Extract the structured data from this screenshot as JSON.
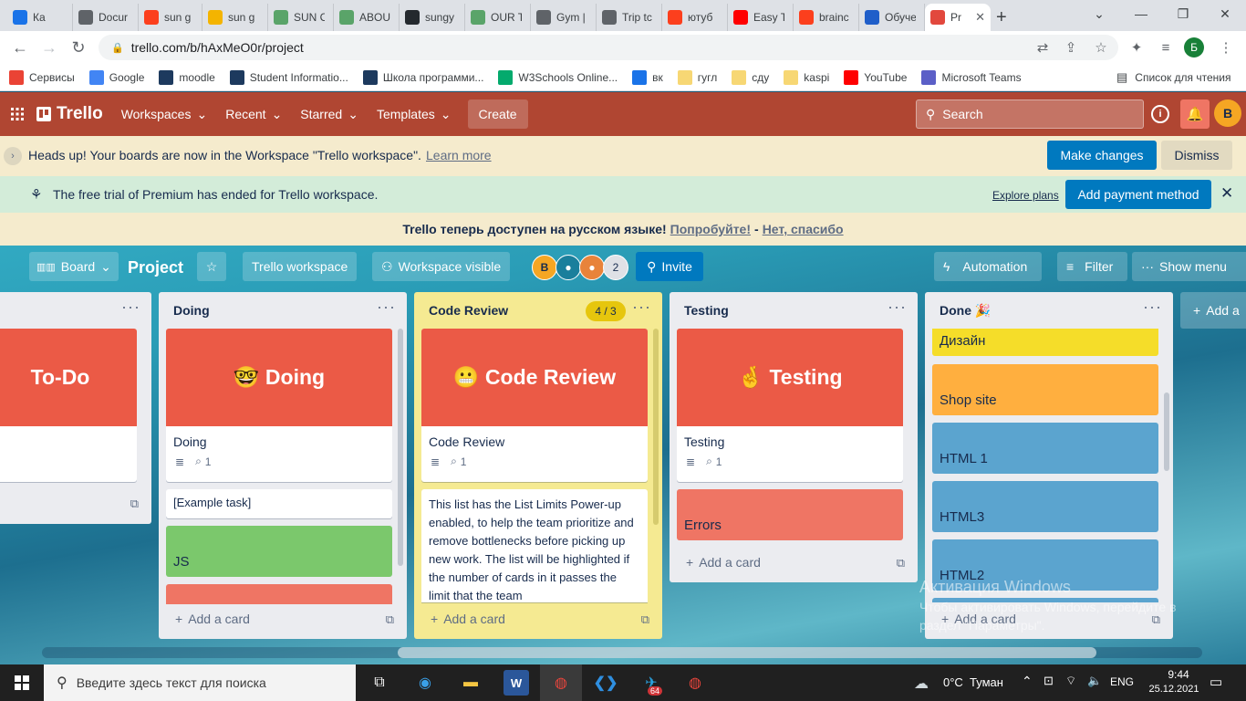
{
  "browser": {
    "tabs": [
      {
        "label": "Ка",
        "icon": "video-icon",
        "color": "#1a73e8",
        "muted": true
      },
      {
        "label": "Docur",
        "icon": "globe-icon",
        "color": "#5f6368"
      },
      {
        "label": "sun g",
        "icon": "yandex-icon",
        "color": "#fc3f1d"
      },
      {
        "label": "sun g",
        "icon": "image-icon",
        "color": "#f4b400"
      },
      {
        "label": "SUN C",
        "icon": "site-icon",
        "color": "#5aa469"
      },
      {
        "label": "ABOU",
        "icon": "site-icon",
        "color": "#5aa469"
      },
      {
        "label": "sungy",
        "icon": "github-icon",
        "color": "#24292e"
      },
      {
        "label": "OUR T",
        "icon": "site-icon",
        "color": "#5aa469"
      },
      {
        "label": "Gym |",
        "icon": "globe-icon",
        "color": "#5f6368"
      },
      {
        "label": "Trip tc",
        "icon": "globe-icon",
        "color": "#5f6368"
      },
      {
        "label": "ютуб",
        "icon": "yandex-icon",
        "color": "#fc3f1d"
      },
      {
        "label": "Easy T",
        "icon": "youtube-icon",
        "color": "#ff0000"
      },
      {
        "label": "brainc",
        "icon": "yandex-icon",
        "color": "#fc3f1d"
      },
      {
        "label": "Обуче",
        "icon": "bc-icon",
        "color": "#1f5ec9"
      },
      {
        "label": "Pr",
        "icon": "trello-icon",
        "color": "#e2483d",
        "active": true
      }
    ],
    "new_tab": "+",
    "url": "trello.com/b/hAxMeO0r/project",
    "profile_initial": "Б",
    "bookmarks": [
      {
        "label": "Сервисы",
        "icon": "apps-icon",
        "color": "#ea4335"
      },
      {
        "label": "Google",
        "icon": "google-icon",
        "color": "#4285f4"
      },
      {
        "label": "moodle",
        "icon": "moodle-icon",
        "color": "#1d3a5e"
      },
      {
        "label": "Student Informatio...",
        "icon": "sdu-icon",
        "color": "#1d3a5e"
      },
      {
        "label": "Школа программи...",
        "icon": "acmp-icon",
        "color": "#1d3a5e"
      },
      {
        "label": "W3Schools Online...",
        "icon": "w3-icon",
        "color": "#04aa6d"
      },
      {
        "label": "вк",
        "icon": "vk-icon",
        "color": "#1a73e8"
      },
      {
        "label": "гугл",
        "icon": "folder-icon",
        "color": "#f7d774"
      },
      {
        "label": "сду",
        "icon": "folder-icon",
        "color": "#f7d774"
      },
      {
        "label": "kaspi",
        "icon": "folder-icon",
        "color": "#f7d774"
      },
      {
        "label": "YouTube",
        "icon": "youtube-icon",
        "color": "#ff0000"
      },
      {
        "label": "Microsoft Teams",
        "icon": "teams-icon",
        "color": "#5b5fc7"
      }
    ],
    "reading_list": "Список для чтения"
  },
  "trello": {
    "logo": "Trello",
    "nav": {
      "workspaces": "Workspaces",
      "recent": "Recent",
      "starred": "Starred",
      "templates": "Templates",
      "create": "Create"
    },
    "search_placeholder": "Search",
    "user_initial": "B",
    "banner_workspace": {
      "text": "Heads up! Your boards are now in the Workspace \"Trello workspace\".",
      "link": "Learn more",
      "primary": "Make changes",
      "secondary": "Dismiss"
    },
    "banner_premium": {
      "text": "The free trial of Premium has ended for Trello workspace.",
      "link": "Explore plans",
      "primary": "Add payment method"
    },
    "banner_language": {
      "text": "Trello теперь доступен на русском языке!",
      "try": "Попробуйте!",
      "sep": "-",
      "no": "Нет, спасибо"
    },
    "board": {
      "view": "Board",
      "name": "Project",
      "workspace": "Trello workspace",
      "visibility": "Workspace visible",
      "members_extra": "2",
      "member_initial": "B",
      "invite": "Invite",
      "automation": "Automation",
      "filter": "Filter",
      "show_menu": "Show menu"
    },
    "lists": {
      "todo": {
        "cover": "To-Do"
      },
      "doing": {
        "title": "Doing",
        "cover": "🤓 Doing",
        "card_title": "Doing",
        "attachments": "1",
        "task": "[Example task]",
        "label_card": "JS"
      },
      "review": {
        "title": "Code Review",
        "limit": "4 / 3",
        "cover": "😬 Code Review",
        "card_title": "Code Review",
        "attachments": "1",
        "description": "This list has the List Limits Power-up enabled, to help the team prioritize and remove bottlenecks before picking up new work. The list will be highlighted if the number of cards in it passes the limit that the team"
      },
      "testing": {
        "title": "Testing",
        "cover": "🤞 Testing",
        "card_title": "Testing",
        "attachments": "1",
        "errors": "Errors"
      },
      "done": {
        "title": "Done 🎉",
        "cards": [
          "Дизайн",
          "Shop site",
          "HTML 1",
          "HTML3",
          "HTML2"
        ]
      },
      "add_list": "Add a"
    },
    "add_card": "Add a card",
    "menu_dots": "···"
  },
  "colors": {
    "header": "#b04632",
    "cover_red": "#eb5a46",
    "green": "#7bc86c",
    "yellow": "#f5dd29",
    "orange": "#ffaf3f",
    "blue": "#5ba4cf",
    "review_bg": "#f5ea92"
  },
  "watermark": {
    "title": "Активация Windows",
    "line1": "Чтобы активировать Windows, перейдите в",
    "line2": "раздел \"Параметры\"."
  },
  "taskbar": {
    "search_placeholder": "Введите здесь текст для поиска",
    "weather": "0°C  Туман",
    "lang": "ENG",
    "time": "9:44",
    "date": "25.12.2021",
    "telegram_badge": "64"
  }
}
